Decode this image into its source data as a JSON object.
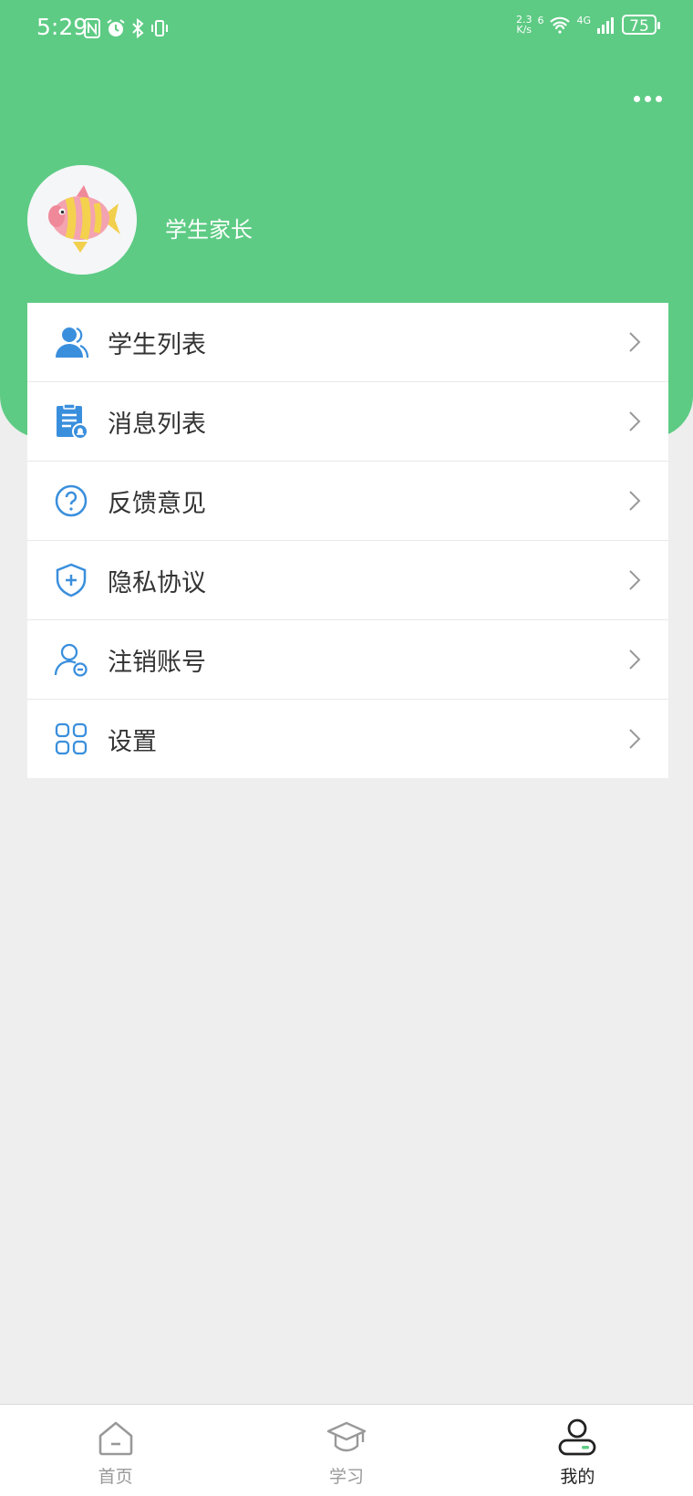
{
  "status_bar": {
    "time": "5:29",
    "network_speed_value": "2.3",
    "network_speed_unit": "K/s",
    "network_type": "4G",
    "wifi_label": "6",
    "battery": "75"
  },
  "header": {
    "username": "学生家长"
  },
  "menu": {
    "items": [
      {
        "label": "学生列表",
        "icon": "students-icon"
      },
      {
        "label": "消息列表",
        "icon": "message-list-icon"
      },
      {
        "label": "反馈意见",
        "icon": "question-icon"
      },
      {
        "label": "隐私协议",
        "icon": "shield-icon"
      },
      {
        "label": "注销账号",
        "icon": "user-remove-icon"
      },
      {
        "label": "设置",
        "icon": "grid-icon"
      }
    ]
  },
  "tabbar": {
    "tabs": [
      {
        "label": "首页",
        "icon": "home-icon",
        "active": false
      },
      {
        "label": "学习",
        "icon": "graduation-cap-icon",
        "active": false
      },
      {
        "label": "我的",
        "icon": "profile-icon",
        "active": true
      }
    ]
  },
  "colors": {
    "brand_green": "#5ecb84",
    "icon_blue": "#3a8fdd",
    "background": "#eeeeee"
  }
}
